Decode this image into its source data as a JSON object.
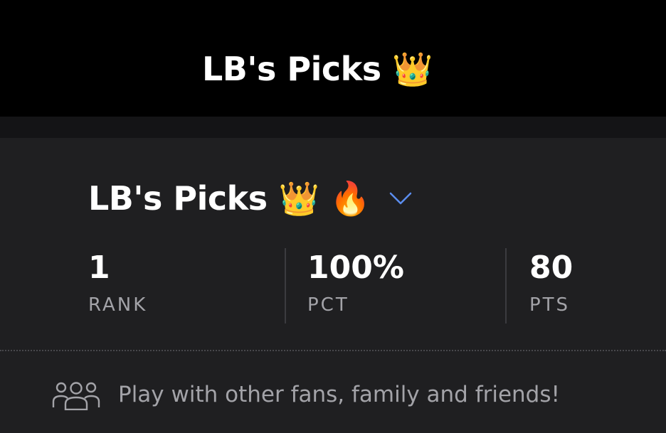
{
  "header": {
    "title": "LB's Picks",
    "title_emoji": "👑"
  },
  "group": {
    "name": "LB's Picks",
    "emojis": "👑 🔥",
    "dropdown_icon": "chevron-down-icon"
  },
  "stats": [
    {
      "value": "1",
      "label": "RANK"
    },
    {
      "value": "100%",
      "label": "PCT"
    },
    {
      "value": "80",
      "label": "PTS"
    }
  ],
  "invite": {
    "icon": "group-people-icon",
    "text": "Play with other fans, family and friends!"
  },
  "colors": {
    "accent": "#5b8def",
    "header_bg": "#000000",
    "card_bg": "#1f1f21",
    "muted_text": "#a3a3a8"
  }
}
